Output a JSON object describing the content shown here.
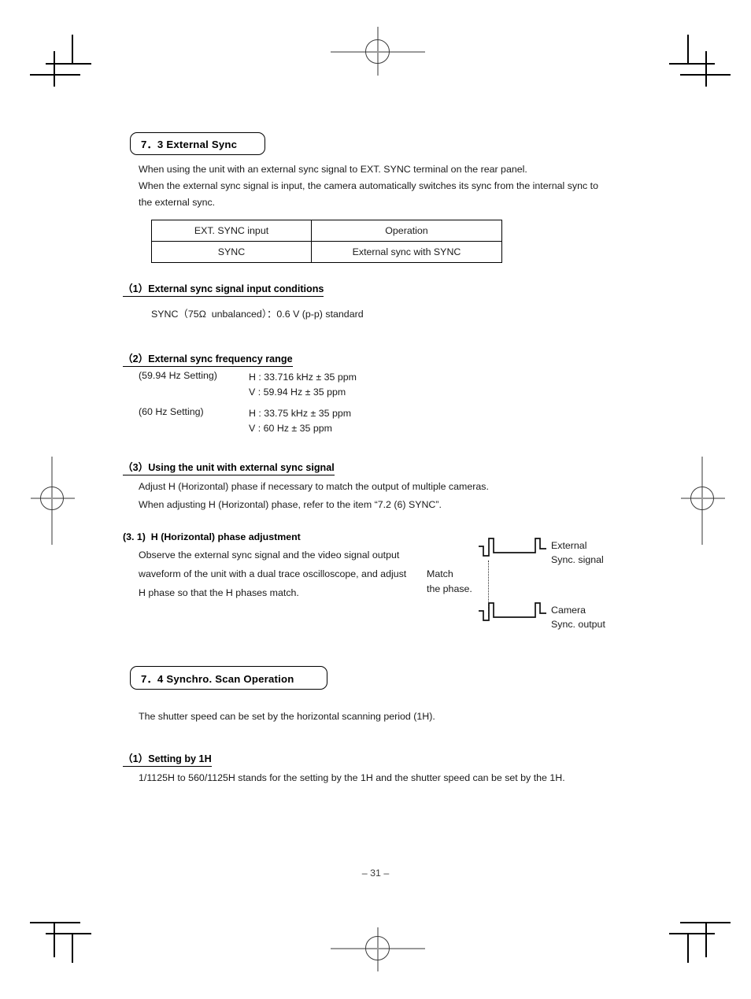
{
  "document": {
    "page_number": "– 31 –"
  },
  "section_73": {
    "box_label": "7．3   External Sync",
    "intro": "When using the unit with an external sync signal to EXT. SYNC terminal on the rear panel.\nWhen the external sync signal is input, the camera automatically switches its sync from the internal sync to\nthe external sync.",
    "table": {
      "headers": [
        "EXT. SYNC input",
        "Operation"
      ],
      "rows": [
        [
          "SYNC",
          "External sync with SYNC"
        ]
      ]
    },
    "sub1": {
      "heading": "（1）External sync signal input conditions",
      "spec": "SYNC（75Ω  unbalanced）：0.6 V (p-p) standard"
    },
    "sub2": {
      "heading": "（2）External sync frequency range",
      "groups": [
        {
          "label": "(59.94 Hz Setting)",
          "values": "H : 33.716 kHz ± 35 ppm\nV : 59.94 Hz ± 35 ppm"
        },
        {
          "label": "(60 Hz Setting)",
          "values": "H : 33.75 kHz ± 35 ppm\nV : 60 Hz ± 35 ppm"
        }
      ]
    },
    "sub3": {
      "heading": "（3）Using the unit with external sync signal",
      "line1": "Adjust H (Horizontal) phase if necessary to match the output of multiple cameras.",
      "line2": "When adjusting H (Horizontal) phase, refer to the item “7.2 (6) SYNC”.",
      "sub31": {
        "heading": "(3. 1)  H (Horizontal) phase adjustment",
        "body": "Observe the external sync signal and the video signal output\n\nwaveform of the unit with a dual trace oscilloscope, and adjust\n\nH phase so that the H phases match.",
        "diagram": {
          "match_note": "Match\nthe phase.",
          "top_label": "External\nSync. signal",
          "bottom_label": "Camera\nSync. output"
        }
      }
    }
  },
  "section_74": {
    "box_label": "7．4   Synchro. Scan Operation",
    "intro": "The shutter speed can be set by the horizontal scanning period (1H).",
    "sub1": {
      "heading": "（1）Setting by 1H",
      "body": "1/1125H to 560/1125H stands for the setting by the 1H and the shutter speed can be set by the 1H."
    }
  }
}
